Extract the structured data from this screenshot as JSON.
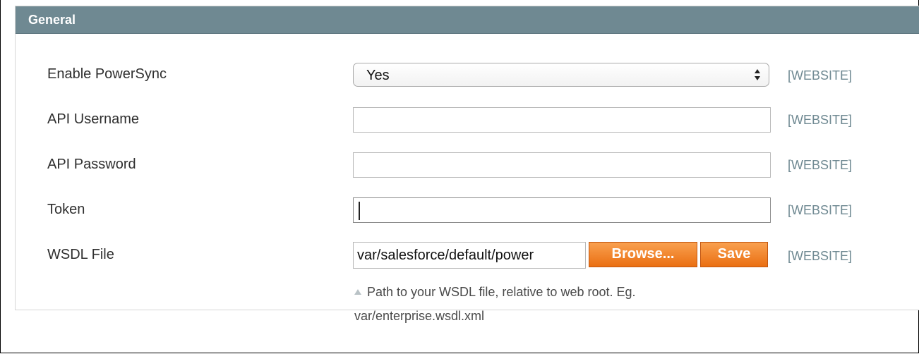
{
  "section": {
    "title": "General"
  },
  "fields": {
    "enable_powersync": {
      "label": "Enable PowerSync",
      "value": "Yes",
      "scope": "[WEBSITE]"
    },
    "api_username": {
      "label": "API Username",
      "value": "",
      "scope": "[WEBSITE]"
    },
    "api_password": {
      "label": "API Password",
      "value": "",
      "scope": "[WEBSITE]"
    },
    "token": {
      "label": "Token",
      "value": "",
      "scope": "[WEBSITE]"
    },
    "wsdl_file": {
      "label": "WSDL File",
      "value": "var/salesforce/default/power",
      "browse_label": "Browse...",
      "save_label": "Save",
      "scope": "[WEBSITE]",
      "note_line1": "Path to your WSDL file, relative to web root. Eg.",
      "note_line2": "var/enterprise.wsdl.xml"
    }
  },
  "colors": {
    "header": "#6f8992",
    "button": "#ea6f12",
    "scope_text": "#6f8992"
  },
  "icons": {
    "select_arrows": "up-down-chevron-icon",
    "note": "triangle-up-icon"
  }
}
